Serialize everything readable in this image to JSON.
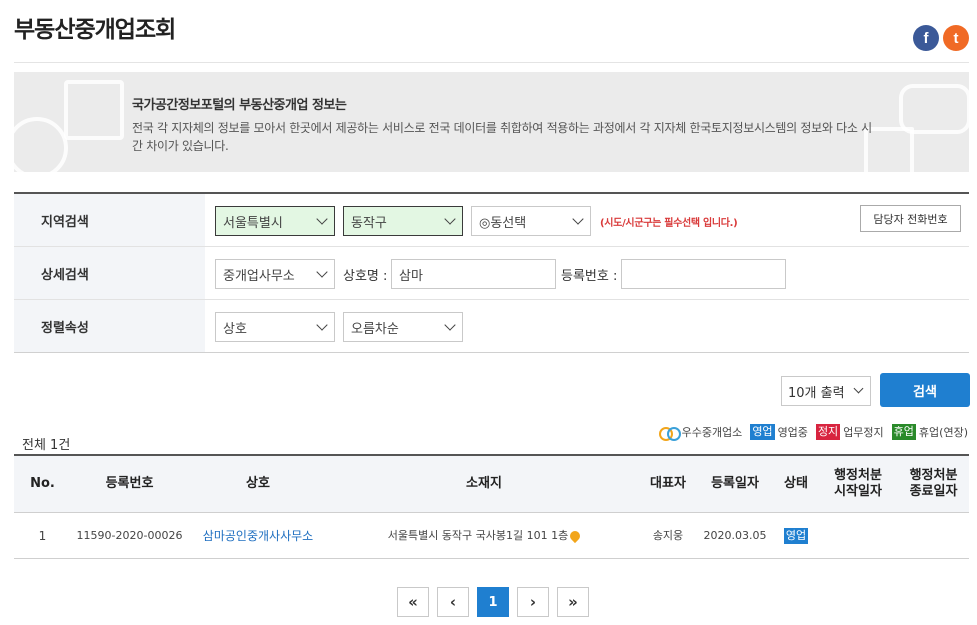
{
  "page": {
    "title": "부동산중개업조회"
  },
  "share": {
    "facebook_glyph": "f",
    "twitter_glyph": "t"
  },
  "banner": {
    "heading": "국가공간정보포털의 부동산중개업 정보는",
    "text": "전국 각 지자체의 정보를 모아서 한곳에서 제공하는 서비스로 전국 데이터를 취합하여 적용하는 과정에서 각 지자체 한국토지정보시스템의 정보와 다소 시간 차이가 있습니다."
  },
  "search": {
    "region_label": "지역검색",
    "sido": "서울특별시",
    "sigungu": "동작구",
    "dong": "◎동선택",
    "required_note": "(시도/시군구는 필수선택 입니다.)",
    "phone_button": "담당자 전화번호",
    "detail_label": "상세검색",
    "category": "중개업사무소",
    "name_label": "상호명 :",
    "name_value": "삼마",
    "reg_label": "등록번호 :",
    "reg_value": "",
    "sort_label": "정렬속성",
    "sort_field": "상호",
    "sort_order": "오름차순"
  },
  "controls": {
    "per_page": "10개 출력",
    "search_button": "검색"
  },
  "results": {
    "total": "전체 1건",
    "legend": {
      "excellent": "우수중개업소",
      "open_badge": "영업",
      "open": "영업중",
      "stop_badge": "정지",
      "stop": "업무정지",
      "rest_badge": "휴업",
      "rest": "휴업(연장)"
    },
    "columns": [
      "No.",
      "등록번호",
      "상호",
      "소재지",
      "대표자",
      "등록일자",
      "상태",
      "행정처분\n시작일자",
      "행정처분\n종료일자"
    ],
    "rows": [
      {
        "no": "1",
        "reg_no": "11590-2020-00026",
        "name": "삼마공인중개사사무소",
        "address": "서울특별시 동작구 국사봉1길 101 1층",
        "ceo": "송지웅",
        "reg_date": "2020.03.05",
        "status": "영업",
        "start": "",
        "end": ""
      }
    ]
  },
  "pager": {
    "first": "«",
    "prev": "‹",
    "current": "1",
    "next": "›",
    "last": "»"
  },
  "colors": {
    "accent": "#1f7fd0",
    "highlight": "#e3f7e3",
    "required": "#d93a3a"
  }
}
